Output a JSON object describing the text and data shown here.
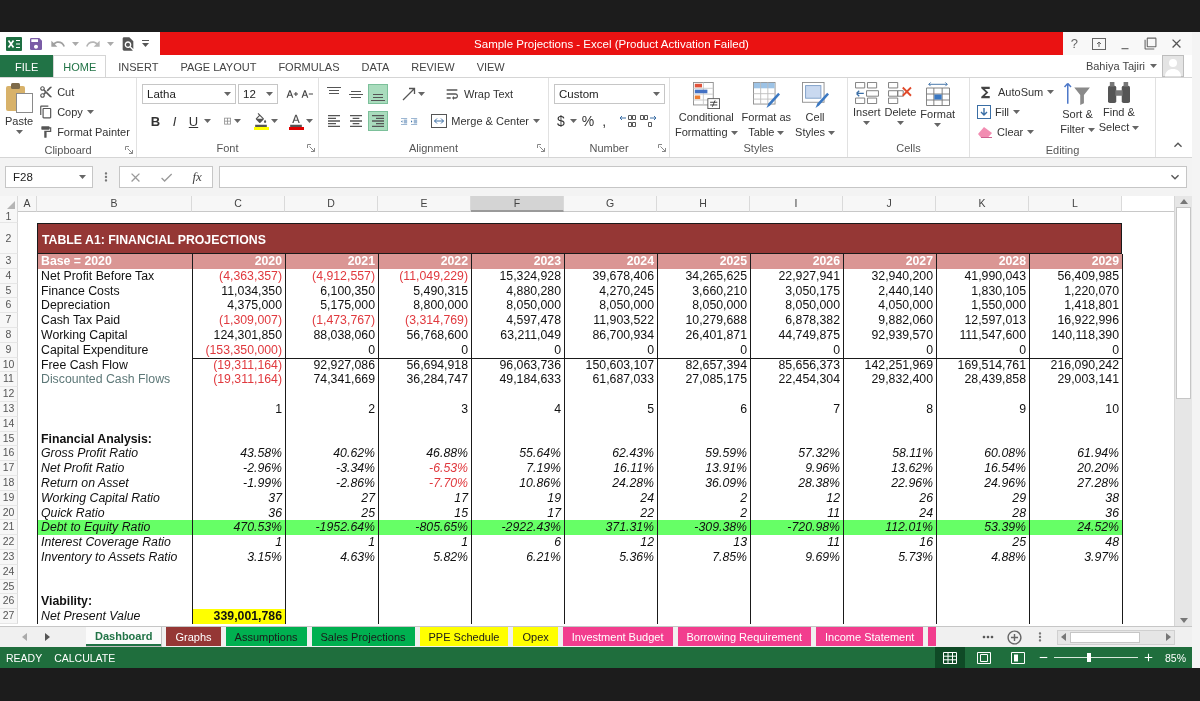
{
  "title_bar": {
    "title": "Sample Projections - Excel (Product Activation Failed)",
    "help": "?"
  },
  "ribbon": {
    "tabs": [
      {
        "label": "FILE",
        "kind": "backstage",
        "selected": false
      },
      {
        "label": "HOME",
        "kind": "tab",
        "selected": true
      },
      {
        "label": "INSERT",
        "kind": "tab",
        "selected": false
      },
      {
        "label": "PAGE LAYOUT",
        "kind": "tab",
        "selected": false
      },
      {
        "label": "FORMULAS",
        "kind": "tab",
        "selected": false
      },
      {
        "label": "DATA",
        "kind": "tab",
        "selected": false
      },
      {
        "label": "REVIEW",
        "kind": "tab",
        "selected": false
      },
      {
        "label": "VIEW",
        "kind": "tab",
        "selected": false
      }
    ],
    "user": "Bahiya Tajiri",
    "clipboard": {
      "label": "Clipboard",
      "paste": "Paste",
      "actions": [
        {
          "kind": "cut",
          "label": "Cut"
        },
        {
          "kind": "copy",
          "label": "Copy"
        },
        {
          "kind": "painter",
          "label": "Format Painter"
        }
      ]
    },
    "font": {
      "label": "Font",
      "name": "Latha",
      "size": "12",
      "styles": [
        {
          "kind": "bold",
          "label": "B"
        },
        {
          "kind": "italic",
          "label": "I"
        },
        {
          "kind": "underline",
          "label": "U"
        }
      ]
    },
    "alignment": {
      "label": "Alignment",
      "vertical": [
        {
          "kind": "top",
          "selected": false
        },
        {
          "kind": "middle",
          "selected": false
        },
        {
          "kind": "bottom",
          "selected": true
        }
      ],
      "horizontal": [
        {
          "kind": "left",
          "selected": false
        },
        {
          "kind": "center",
          "selected": false
        },
        {
          "kind": "right",
          "selected": true
        }
      ],
      "wrap_text": "Wrap Text",
      "merge": "Merge & Center"
    },
    "number": {
      "label": "Number",
      "format": "Custom",
      "symbols": [
        {
          "kind": "currency",
          "label": "$"
        },
        {
          "kind": "percent",
          "label": "%"
        },
        {
          "kind": "comma",
          "label": ","
        }
      ]
    },
    "styles": {
      "label": "Styles",
      "buttons": [
        {
          "kind": "conditional",
          "lines": [
            "Conditional",
            "Formatting"
          ]
        },
        {
          "kind": "table",
          "lines": [
            "Format as",
            "Table"
          ]
        },
        {
          "kind": "cell_styles",
          "lines": [
            "Cell",
            "Styles"
          ]
        }
      ]
    },
    "cells": {
      "label": "Cells",
      "buttons": [
        {
          "kind": "insert",
          "label": "Insert"
        },
        {
          "kind": "delete",
          "label": "Delete"
        },
        {
          "kind": "format",
          "label": "Format"
        }
      ]
    },
    "editing": {
      "label": "Editing",
      "actions": [
        {
          "kind": "autosum",
          "label": "AutoSum"
        },
        {
          "kind": "fill",
          "label": "Fill"
        },
        {
          "kind": "clear",
          "label": "Clear"
        }
      ],
      "buttons": [
        {
          "kind": "sort",
          "lines": [
            "Sort &",
            "Filter"
          ]
        },
        {
          "kind": "find",
          "lines": [
            "Find &",
            "Select"
          ]
        }
      ]
    }
  },
  "formula_bar": {
    "name_box": "F28",
    "insert_function": "fx"
  },
  "sheet": {
    "columns": [
      {
        "label": "A",
        "selected": false
      },
      {
        "label": "B",
        "selected": false
      },
      {
        "label": "C",
        "selected": false
      },
      {
        "label": "D",
        "selected": false
      },
      {
        "label": "E",
        "selected": false
      },
      {
        "label": "F",
        "selected": true
      },
      {
        "label": "G",
        "selected": false
      },
      {
        "label": "H",
        "selected": false
      },
      {
        "label": "I",
        "selected": false
      },
      {
        "label": "J",
        "selected": false
      },
      {
        "label": "K",
        "selected": false
      },
      {
        "label": "L",
        "selected": false
      }
    ],
    "rows": [
      {
        "number": "1",
        "kind": "blank"
      },
      {
        "number": "2",
        "kind": "title",
        "text": "TABLE A1: FINANCIAL PROJECTIONS"
      },
      {
        "number": "3",
        "kind": "header",
        "label": "Base = 2020",
        "cells": [
          "2020",
          "2021",
          "2022",
          "2023",
          "2024",
          "2025",
          "2026",
          "2027",
          "2028",
          "2029"
        ]
      },
      {
        "number": "4",
        "kind": "value",
        "label": "Net Profit Before Tax",
        "cells": [
          {
            "text": "(4,363,357)",
            "negative": true
          },
          {
            "text": "(4,912,557)",
            "negative": true
          },
          {
            "text": "(11,049,229)",
            "negative": true
          },
          {
            "text": "15,324,928",
            "negative": false
          },
          {
            "text": "39,678,406",
            "negative": false
          },
          {
            "text": "34,265,625",
            "negative": false
          },
          {
            "text": "22,927,941",
            "negative": false
          },
          {
            "text": "32,940,200",
            "negative": false
          },
          {
            "text": "41,990,043",
            "negative": false
          },
          {
            "text": "56,409,985",
            "negative": false
          }
        ]
      },
      {
        "number": "5",
        "kind": "value",
        "label": "Finance Costs",
        "cells": [
          {
            "text": "11,034,350",
            "negative": false
          },
          {
            "text": "6,100,350",
            "negative": false
          },
          {
            "text": "5,490,315",
            "negative": false
          },
          {
            "text": "4,880,280",
            "negative": false
          },
          {
            "text": "4,270,245",
            "negative": false
          },
          {
            "text": "3,660,210",
            "negative": false
          },
          {
            "text": "3,050,175",
            "negative": false
          },
          {
            "text": "2,440,140",
            "negative": false
          },
          {
            "text": "1,830,105",
            "negative": false
          },
          {
            "text": "1,220,070",
            "negative": false
          }
        ]
      },
      {
        "number": "6",
        "kind": "value",
        "label": "Depreciation",
        "cells": [
          {
            "text": "4,375,000",
            "negative": false
          },
          {
            "text": "5,175,000",
            "negative": false
          },
          {
            "text": "8,800,000",
            "negative": false
          },
          {
            "text": "8,050,000",
            "negative": false
          },
          {
            "text": "8,050,000",
            "negative": false
          },
          {
            "text": "8,050,000",
            "negative": false
          },
          {
            "text": "8,050,000",
            "negative": false
          },
          {
            "text": "4,050,000",
            "negative": false
          },
          {
            "text": "1,550,000",
            "negative": false
          },
          {
            "text": "1,418,801",
            "negative": false
          }
        ]
      },
      {
        "number": "7",
        "kind": "value",
        "label": "Cash Tax Paid",
        "cells": [
          {
            "text": "(1,309,007)",
            "negative": true
          },
          {
            "text": "(1,473,767)",
            "negative": true
          },
          {
            "text": "(3,314,769)",
            "negative": true
          },
          {
            "text": "4,597,478",
            "negative": false
          },
          {
            "text": "11,903,522",
            "negative": false
          },
          {
            "text": "10,279,688",
            "negative": false
          },
          {
            "text": "6,878,382",
            "negative": false
          },
          {
            "text": "9,882,060",
            "negative": false
          },
          {
            "text": "12,597,013",
            "negative": false
          },
          {
            "text": "16,922,996",
            "negative": false
          }
        ]
      },
      {
        "number": "8",
        "kind": "value",
        "label": "Working Capital",
        "cells": [
          {
            "text": "124,301,850",
            "negative": false
          },
          {
            "text": "88,038,060",
            "negative": false
          },
          {
            "text": "56,768,600",
            "negative": false
          },
          {
            "text": "63,211,049",
            "negative": false
          },
          {
            "text": "86,700,934",
            "negative": false
          },
          {
            "text": "26,401,871",
            "negative": false
          },
          {
            "text": "44,749,875",
            "negative": false
          },
          {
            "text": "92,939,570",
            "negative": false
          },
          {
            "text": "111,547,600",
            "negative": false
          },
          {
            "text": "140,118,390",
            "negative": false
          }
        ]
      },
      {
        "number": "9",
        "kind": "value",
        "label": "Capital Expenditure",
        "cells": [
          {
            "text": "(153,350,000)",
            "negative": true
          },
          {
            "text": "0",
            "negative": false
          },
          {
            "text": "0",
            "negative": false
          },
          {
            "text": "0",
            "negative": false
          },
          {
            "text": "0",
            "negative": false
          },
          {
            "text": "0",
            "negative": false
          },
          {
            "text": "0",
            "negative": false
          },
          {
            "text": "0",
            "negative": false
          },
          {
            "text": "0",
            "negative": false
          },
          {
            "text": "0",
            "negative": false
          }
        ]
      },
      {
        "number": "10",
        "kind": "total",
        "label": "Free Cash Flow",
        "cells": [
          {
            "text": "(19,311,164)",
            "negative": true
          },
          {
            "text": "92,927,086",
            "negative": false
          },
          {
            "text": "56,694,918",
            "negative": false
          },
          {
            "text": "96,063,736",
            "negative": false
          },
          {
            "text": "150,603,107",
            "negative": false
          },
          {
            "text": "82,657,394",
            "negative": false
          },
          {
            "text": "85,656,373",
            "negative": false
          },
          {
            "text": "142,251,969",
            "negative": false
          },
          {
            "text": "169,514,761",
            "negative": false
          },
          {
            "text": "216,090,242",
            "negative": false
          }
        ]
      },
      {
        "number": "11",
        "kind": "muted",
        "label": "Discounted Cash Flows",
        "cells": [
          {
            "text": "(19,311,164)",
            "negative": true
          },
          {
            "text": "74,341,669",
            "negative": false
          },
          {
            "text": "36,284,747",
            "negative": false
          },
          {
            "text": "49,184,633",
            "negative": false
          },
          {
            "text": "61,687,033",
            "negative": false
          },
          {
            "text": "27,085,175",
            "negative": false
          },
          {
            "text": "22,454,304",
            "negative": false
          },
          {
            "text": "29,832,400",
            "negative": false
          },
          {
            "text": "28,439,858",
            "negative": false
          },
          {
            "text": "29,003,141",
            "negative": false
          }
        ]
      },
      {
        "number": "12",
        "kind": "blank"
      },
      {
        "number": "13",
        "kind": "index",
        "cells": [
          "1",
          "2",
          "3",
          "4",
          "5",
          "6",
          "7",
          "8",
          "9",
          "10"
        ]
      },
      {
        "number": "14",
        "kind": "blank"
      },
      {
        "number": "15",
        "kind": "section",
        "label": "Financial Analysis:"
      },
      {
        "number": "16",
        "kind": "ratio",
        "highlighted": false,
        "label": "Gross Profit Ratio",
        "cells": [
          {
            "text": "43.58%",
            "negative": false
          },
          {
            "text": "40.62%",
            "negative": false
          },
          {
            "text": "46.88%",
            "negative": false
          },
          {
            "text": "55.64%",
            "negative": false
          },
          {
            "text": "62.43%",
            "negative": false
          },
          {
            "text": "59.59%",
            "negative": false
          },
          {
            "text": "57.32%",
            "negative": false
          },
          {
            "text": "58.11%",
            "negative": false
          },
          {
            "text": "60.08%",
            "negative": false
          },
          {
            "text": "61.94%",
            "negative": false
          }
        ]
      },
      {
        "number": "17",
        "kind": "ratio",
        "highlighted": false,
        "label": "Net Profit Ratio",
        "cells": [
          {
            "text": "-2.96%",
            "negative": false
          },
          {
            "text": "-3.34%",
            "negative": false
          },
          {
            "text": "-6.53%",
            "negative": true
          },
          {
            "text": "7.19%",
            "negative": false
          },
          {
            "text": "16.11%",
            "negative": false
          },
          {
            "text": "13.91%",
            "negative": false
          },
          {
            "text": "9.96%",
            "negative": false
          },
          {
            "text": "13.62%",
            "negative": false
          },
          {
            "text": "16.54%",
            "negative": false
          },
          {
            "text": "20.20%",
            "negative": false
          }
        ]
      },
      {
        "number": "18",
        "kind": "ratio",
        "highlighted": false,
        "label": "Return on Asset",
        "cells": [
          {
            "text": "-1.99%",
            "negative": false
          },
          {
            "text": "-2.86%",
            "negative": false
          },
          {
            "text": "-7.70%",
            "negative": true
          },
          {
            "text": "10.86%",
            "negative": false
          },
          {
            "text": "24.28%",
            "negative": false
          },
          {
            "text": "36.09%",
            "negative": false
          },
          {
            "text": "28.38%",
            "negative": false
          },
          {
            "text": "22.96%",
            "negative": false
          },
          {
            "text": "24.96%",
            "negative": false
          },
          {
            "text": "27.28%",
            "negative": false
          }
        ]
      },
      {
        "number": "19",
        "kind": "ratio",
        "highlighted": false,
        "label": "Working Capital Ratio",
        "cells": [
          {
            "text": "37",
            "negative": false
          },
          {
            "text": "27",
            "negative": false
          },
          {
            "text": "17",
            "negative": false
          },
          {
            "text": "19",
            "negative": false
          },
          {
            "text": "24",
            "negative": false
          },
          {
            "text": "2",
            "negative": false
          },
          {
            "text": "12",
            "negative": false
          },
          {
            "text": "26",
            "negative": false
          },
          {
            "text": "29",
            "negative": false
          },
          {
            "text": "38",
            "negative": false
          }
        ]
      },
      {
        "number": "20",
        "kind": "ratio",
        "highlighted": false,
        "label": "Quick Ratio",
        "cells": [
          {
            "text": "36",
            "negative": false
          },
          {
            "text": "25",
            "negative": false
          },
          {
            "text": "15",
            "negative": false
          },
          {
            "text": "17",
            "negative": false
          },
          {
            "text": "22",
            "negative": false
          },
          {
            "text": "2",
            "negative": false
          },
          {
            "text": "11",
            "negative": false
          },
          {
            "text": "24",
            "negative": false
          },
          {
            "text": "28",
            "negative": false
          },
          {
            "text": "36",
            "negative": false
          }
        ]
      },
      {
        "number": "21",
        "kind": "ratio",
        "highlighted": true,
        "label": "Debt to Equity Ratio",
        "cells": [
          {
            "text": "470.53%",
            "negative": false
          },
          {
            "text": "-1952.64%",
            "negative": false
          },
          {
            "text": "-805.65%",
            "negative": false
          },
          {
            "text": "-2922.43%",
            "negative": false
          },
          {
            "text": "371.31%",
            "negative": false
          },
          {
            "text": "-309.38%",
            "negative": false
          },
          {
            "text": "-720.98%",
            "negative": false
          },
          {
            "text": "112.01%",
            "negative": false
          },
          {
            "text": "53.39%",
            "negative": false
          },
          {
            "text": "24.52%",
            "negative": false
          }
        ]
      },
      {
        "number": "22",
        "kind": "ratio",
        "highlighted": false,
        "label": "Interest Coverage Ratio",
        "cells": [
          {
            "text": "1",
            "negative": false
          },
          {
            "text": "1",
            "negative": false
          },
          {
            "text": "1",
            "negative": false
          },
          {
            "text": "6",
            "negative": false
          },
          {
            "text": "12",
            "negative": false
          },
          {
            "text": "13",
            "negative": false
          },
          {
            "text": "11",
            "negative": false
          },
          {
            "text": "16",
            "negative": false
          },
          {
            "text": "25",
            "negative": false
          },
          {
            "text": "48",
            "negative": false
          }
        ]
      },
      {
        "number": "23",
        "kind": "ratio",
        "highlighted": false,
        "label": "Inventory to Assets Ratio",
        "cells": [
          {
            "text": "3.15%",
            "negative": false
          },
          {
            "text": "4.63%",
            "negative": false
          },
          {
            "text": "5.82%",
            "negative": false
          },
          {
            "text": "6.21%",
            "negative": false
          },
          {
            "text": "5.36%",
            "negative": false
          },
          {
            "text": "7.85%",
            "negative": false
          },
          {
            "text": "9.69%",
            "negative": false
          },
          {
            "text": "5.73%",
            "negative": false
          },
          {
            "text": "4.88%",
            "negative": false
          },
          {
            "text": "3.97%",
            "negative": false
          }
        ]
      },
      {
        "number": "24",
        "kind": "blank"
      },
      {
        "number": "25",
        "kind": "blank"
      },
      {
        "number": "26",
        "kind": "section",
        "label": "Viability:"
      },
      {
        "number": "27",
        "kind": "npv",
        "label": "Net Present Value",
        "cells": [
          {
            "text": "339,001,786",
            "highlighted": true
          }
        ]
      }
    ]
  },
  "sheet_tabs": [
    {
      "label": "Dashboard",
      "color": "#217346",
      "selected": true
    },
    {
      "label": "Graphs",
      "color": "#953735",
      "selected": false
    },
    {
      "label": "Assumptions",
      "color": "#00b050",
      "selected": false
    },
    {
      "label": "Sales Projections",
      "color": "#00b050",
      "selected": false
    },
    {
      "label": "PPE Schedule",
      "color": "#ffff00",
      "selected": false
    },
    {
      "label": "Opex",
      "color": "#ffff00",
      "selected": false
    },
    {
      "label": "Investment Budget",
      "color": "#f23d8e",
      "selected": false
    },
    {
      "label": "Borrowing Requirement",
      "color": "#f23d8e",
      "selected": false
    },
    {
      "label": "Income Statement",
      "color": "#f23d8e",
      "selected": false
    },
    {
      "color": "#f23d8e",
      "selected": false
    }
  ],
  "status_bar": {
    "modes": [
      "READY",
      "CALCULATE"
    ],
    "views": [
      {
        "kind": "normal",
        "selected": true
      },
      {
        "kind": "page_layout",
        "selected": false
      },
      {
        "kind": "page_break",
        "selected": false
      }
    ],
    "zoom": {
      "level": 0.42,
      "reading": "85%"
    }
  }
}
